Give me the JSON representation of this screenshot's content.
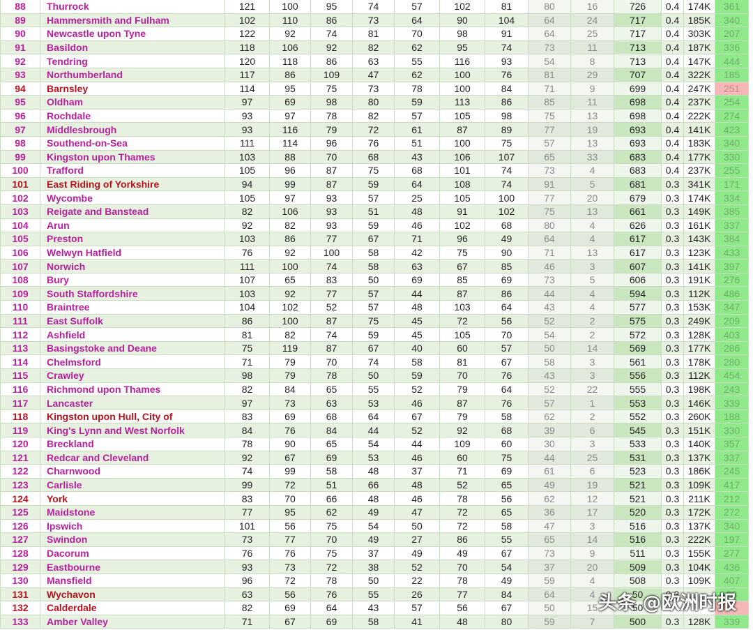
{
  "colors": {
    "name_default": "#b8209e",
    "name_highlight": "#b8121e",
    "row_alt": "#e6f1e0",
    "last_col": "#8fe98a",
    "last_col_flag": "#f5b8b8"
  },
  "rows": [
    [
      "88",
      "Thurrock",
      "121",
      "100",
      "95",
      "74",
      "57",
      "102",
      "81",
      "80",
      "16",
      "726",
      "0.4",
      "174K",
      "361",
      "mag",
      ""
    ],
    [
      "89",
      "Hammersmith and Fulham",
      "102",
      "110",
      "86",
      "73",
      "64",
      "90",
      "104",
      "64",
      "24",
      "717",
      "0.4",
      "185K",
      "340",
      "mag",
      ""
    ],
    [
      "90",
      "Newcastle upon Tyne",
      "122",
      "92",
      "74",
      "81",
      "70",
      "98",
      "91",
      "64",
      "25",
      "717",
      "0.4",
      "303K",
      "207",
      "mag",
      ""
    ],
    [
      "91",
      "Basildon",
      "118",
      "106",
      "92",
      "82",
      "62",
      "95",
      "74",
      "73",
      "11",
      "713",
      "0.4",
      "187K",
      "336",
      "mag",
      ""
    ],
    [
      "92",
      "Tendring",
      "120",
      "118",
      "86",
      "63",
      "55",
      "116",
      "93",
      "54",
      "8",
      "713",
      "0.4",
      "147K",
      "444",
      "mag",
      ""
    ],
    [
      "93",
      "Northumberland",
      "117",
      "86",
      "109",
      "47",
      "62",
      "100",
      "76",
      "81",
      "29",
      "707",
      "0.4",
      "322K",
      "185",
      "mag",
      ""
    ],
    [
      "94",
      "Barnsley",
      "114",
      "95",
      "75",
      "73",
      "78",
      "100",
      "84",
      "71",
      "9",
      "699",
      "0.4",
      "247K",
      "251",
      "red",
      "pink"
    ],
    [
      "95",
      "Oldham",
      "97",
      "69",
      "98",
      "80",
      "59",
      "113",
      "86",
      "85",
      "11",
      "698",
      "0.4",
      "237K",
      "254",
      "mag",
      ""
    ],
    [
      "96",
      "Rochdale",
      "93",
      "97",
      "78",
      "82",
      "57",
      "105",
      "98",
      "75",
      "13",
      "698",
      "0.4",
      "222K",
      "274",
      "mag",
      ""
    ],
    [
      "97",
      "Middlesbrough",
      "93",
      "116",
      "79",
      "72",
      "61",
      "87",
      "89",
      "77",
      "19",
      "693",
      "0.4",
      "141K",
      "423",
      "mag",
      ""
    ],
    [
      "98",
      "Southend-on-Sea",
      "111",
      "114",
      "96",
      "76",
      "51",
      "100",
      "75",
      "57",
      "13",
      "693",
      "0.4",
      "183K",
      "340",
      "mag",
      ""
    ],
    [
      "99",
      "Kingston upon Thames",
      "103",
      "88",
      "70",
      "68",
      "43",
      "106",
      "107",
      "65",
      "33",
      "683",
      "0.4",
      "177K",
      "330",
      "mag",
      ""
    ],
    [
      "100",
      "Trafford",
      "105",
      "96",
      "87",
      "75",
      "68",
      "101",
      "74",
      "73",
      "4",
      "683",
      "0.4",
      "237K",
      "255",
      "mag",
      ""
    ],
    [
      "101",
      "East Riding of Yorkshire",
      "94",
      "99",
      "87",
      "59",
      "64",
      "108",
      "74",
      "91",
      "5",
      "681",
      "0.3",
      "341K",
      "171",
      "red",
      ""
    ],
    [
      "102",
      "Wycombe",
      "105",
      "97",
      "93",
      "57",
      "25",
      "105",
      "100",
      "77",
      "20",
      "679",
      "0.3",
      "174K",
      "334",
      "mag",
      ""
    ],
    [
      "103",
      "Reigate and Banstead",
      "82",
      "106",
      "93",
      "51",
      "48",
      "91",
      "102",
      "75",
      "13",
      "661",
      "0.3",
      "149K",
      "385",
      "mag",
      ""
    ],
    [
      "104",
      "Arun",
      "92",
      "82",
      "93",
      "59",
      "46",
      "102",
      "68",
      "80",
      "4",
      "626",
      "0.3",
      "161K",
      "337",
      "mag",
      ""
    ],
    [
      "105",
      "Preston",
      "103",
      "86",
      "77",
      "67",
      "71",
      "96",
      "49",
      "64",
      "4",
      "617",
      "0.3",
      "143K",
      "384",
      "mag",
      ""
    ],
    [
      "106",
      "Welwyn Hatfield",
      "76",
      "92",
      "100",
      "58",
      "42",
      "75",
      "90",
      "71",
      "13",
      "617",
      "0.3",
      "123K",
      "433",
      "mag",
      ""
    ],
    [
      "107",
      "Norwich",
      "111",
      "100",
      "74",
      "58",
      "63",
      "67",
      "85",
      "46",
      "3",
      "607",
      "0.3",
      "141K",
      "397",
      "mag",
      ""
    ],
    [
      "108",
      "Bury",
      "107",
      "65",
      "83",
      "50",
      "69",
      "85",
      "69",
      "73",
      "5",
      "606",
      "0.3",
      "191K",
      "276",
      "mag",
      ""
    ],
    [
      "109",
      "South Staffordshire",
      "103",
      "92",
      "77",
      "57",
      "44",
      "87",
      "86",
      "44",
      "4",
      "594",
      "0.3",
      "112K",
      "486",
      "mag",
      ""
    ],
    [
      "110",
      "Braintree",
      "104",
      "102",
      "52",
      "57",
      "48",
      "103",
      "64",
      "43",
      "4",
      "577",
      "0.3",
      "153K",
      "347",
      "mag",
      ""
    ],
    [
      "111",
      "East Suffolk",
      "86",
      "100",
      "87",
      "75",
      "45",
      "72",
      "56",
      "52",
      "2",
      "575",
      "0.3",
      "249K",
      "209",
      "mag",
      ""
    ],
    [
      "112",
      "Ashfield",
      "81",
      "82",
      "74",
      "59",
      "45",
      "105",
      "70",
      "54",
      "2",
      "572",
      "0.3",
      "128K",
      "403",
      "mag",
      ""
    ],
    [
      "113",
      "Basingstoke and Deane",
      "75",
      "119",
      "87",
      "67",
      "40",
      "60",
      "57",
      "50",
      "14",
      "569",
      "0.3",
      "177K",
      "286",
      "mag",
      ""
    ],
    [
      "114",
      "Chelmsford",
      "71",
      "79",
      "70",
      "74",
      "58",
      "81",
      "67",
      "58",
      "3",
      "561",
      "0.3",
      "178K",
      "280",
      "mag",
      ""
    ],
    [
      "115",
      "Crawley",
      "98",
      "79",
      "78",
      "50",
      "59",
      "70",
      "76",
      "43",
      "3",
      "556",
      "0.3",
      "112K",
      "454",
      "mag",
      ""
    ],
    [
      "116",
      "Richmond upon Thames",
      "82",
      "84",
      "65",
      "55",
      "52",
      "79",
      "64",
      "52",
      "22",
      "555",
      "0.3",
      "198K",
      "243",
      "mag",
      ""
    ],
    [
      "117",
      "Lancaster",
      "97",
      "73",
      "63",
      "53",
      "46",
      "87",
      "76",
      "57",
      "1",
      "553",
      "0.3",
      "146K",
      "339",
      "mag",
      ""
    ],
    [
      "118",
      "Kingston upon Hull, City of",
      "83",
      "69",
      "68",
      "64",
      "67",
      "79",
      "58",
      "62",
      "2",
      "552",
      "0.3",
      "260K",
      "188",
      "red",
      ""
    ],
    [
      "119",
      "King's Lynn and West Norfolk",
      "84",
      "76",
      "84",
      "44",
      "52",
      "92",
      "68",
      "39",
      "6",
      "545",
      "0.3",
      "151K",
      "330",
      "mag",
      ""
    ],
    [
      "120",
      "Breckland",
      "78",
      "90",
      "65",
      "54",
      "44",
      "109",
      "60",
      "30",
      "3",
      "533",
      "0.3",
      "140K",
      "357",
      "mag",
      ""
    ],
    [
      "121",
      "Redcar and Cleveland",
      "92",
      "67",
      "69",
      "53",
      "46",
      "60",
      "75",
      "44",
      "25",
      "531",
      "0.3",
      "137K",
      "337",
      "mag",
      ""
    ],
    [
      "122",
      "Charnwood",
      "74",
      "99",
      "58",
      "48",
      "37",
      "71",
      "69",
      "61",
      "6",
      "523",
      "0.3",
      "186K",
      "245",
      "mag",
      ""
    ],
    [
      "123",
      "Carlisle",
      "99",
      "72",
      "51",
      "66",
      "48",
      "52",
      "65",
      "49",
      "19",
      "521",
      "0.3",
      "109K",
      "417",
      "mag",
      ""
    ],
    [
      "124",
      "York",
      "83",
      "70",
      "66",
      "48",
      "46",
      "78",
      "56",
      "62",
      "12",
      "521",
      "0.3",
      "211K",
      "212",
      "red",
      ""
    ],
    [
      "125",
      "Maidstone",
      "77",
      "95",
      "62",
      "49",
      "47",
      "72",
      "65",
      "36",
      "17",
      "520",
      "0.3",
      "172K",
      "272",
      "mag",
      ""
    ],
    [
      "126",
      "Ipswich",
      "101",
      "56",
      "75",
      "54",
      "50",
      "72",
      "58",
      "47",
      "3",
      "516",
      "0.3",
      "137K",
      "340",
      "mag",
      ""
    ],
    [
      "127",
      "Swindon",
      "73",
      "77",
      "70",
      "49",
      "27",
      "86",
      "55",
      "65",
      "14",
      "516",
      "0.3",
      "222K",
      "197",
      "mag",
      ""
    ],
    [
      "128",
      "Dacorum",
      "76",
      "76",
      "75",
      "37",
      "49",
      "49",
      "67",
      "73",
      "9",
      "511",
      "0.3",
      "155K",
      "277",
      "mag",
      ""
    ],
    [
      "129",
      "Eastbourne",
      "93",
      "73",
      "72",
      "38",
      "52",
      "70",
      "54",
      "37",
      "20",
      "509",
      "0.3",
      "104K",
      "436",
      "mag",
      ""
    ],
    [
      "130",
      "Mansfield",
      "96",
      "72",
      "78",
      "50",
      "22",
      "78",
      "49",
      "59",
      "4",
      "508",
      "0.3",
      "109K",
      "407",
      "mag",
      ""
    ],
    [
      "131",
      "Wychavon",
      "63",
      "56",
      "76",
      "55",
      "26",
      "77",
      "84",
      "64",
      "4",
      "50",
      "0.3",
      "",
      "28",
      "red",
      ""
    ],
    [
      "132",
      "Calderdale",
      "82",
      "69",
      "64",
      "43",
      "57",
      "56",
      "67",
      "50",
      "15",
      "50",
      "",
      "",
      "",
      "red",
      "pink"
    ],
    [
      "133",
      "Amber Valley",
      "71",
      "67",
      "69",
      "58",
      "41",
      "48",
      "80",
      "59",
      "7",
      "500",
      "0.3",
      "128K",
      "339",
      "mag",
      ""
    ]
  ],
  "watermark": "头条 @欧洲时报"
}
